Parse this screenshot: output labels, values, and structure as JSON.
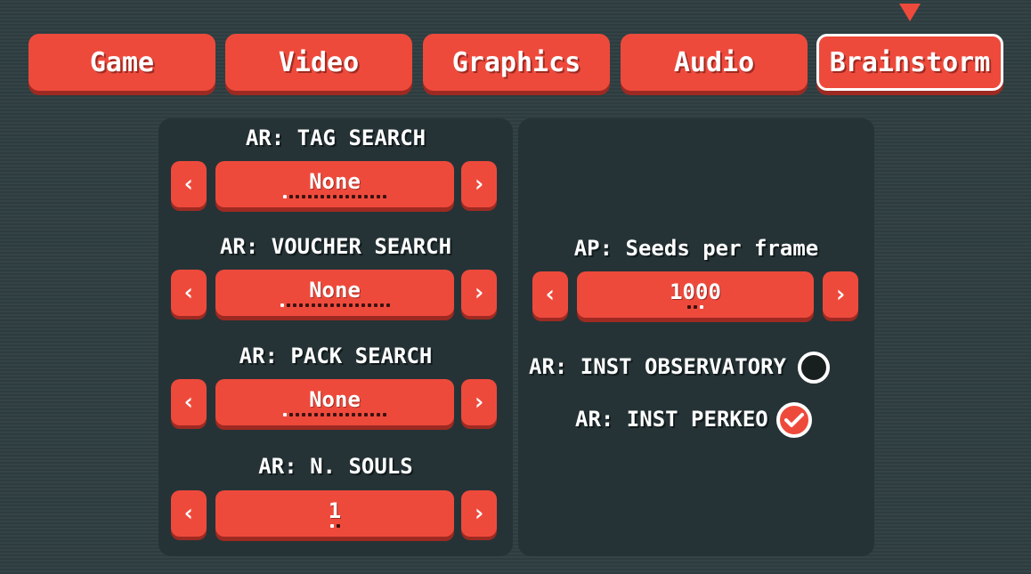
{
  "tabs": [
    {
      "label": "Game"
    },
    {
      "label": "Video"
    },
    {
      "label": "Graphics"
    },
    {
      "label": "Audio"
    },
    {
      "label": "Brainstorm",
      "active": true
    }
  ],
  "left": {
    "tag_search": {
      "label": "AR: TAG SEARCH",
      "value": "None"
    },
    "voucher_search": {
      "label": "AR: VOUCHER SEARCH",
      "value": "None"
    },
    "pack_search": {
      "label": "AR: PACK SEARCH",
      "value": "None"
    },
    "n_souls": {
      "label": "AR: N. SOULS",
      "value": "1"
    }
  },
  "right": {
    "seeds_per_frame": {
      "label": "AP: Seeds per frame",
      "value": "1000"
    },
    "inst_observatory": {
      "label": "AR: INST OBSERVATORY",
      "checked": false
    },
    "inst_perkeo": {
      "label": "AR: INST PERKEO",
      "checked": true
    }
  },
  "glyphs": {
    "left_arrow": "‹",
    "right_arrow": "›"
  },
  "colors": {
    "accent": "#ee4a3c",
    "accent_shadow": "#9d2a22",
    "panel": "#263336",
    "background": "#334346"
  }
}
